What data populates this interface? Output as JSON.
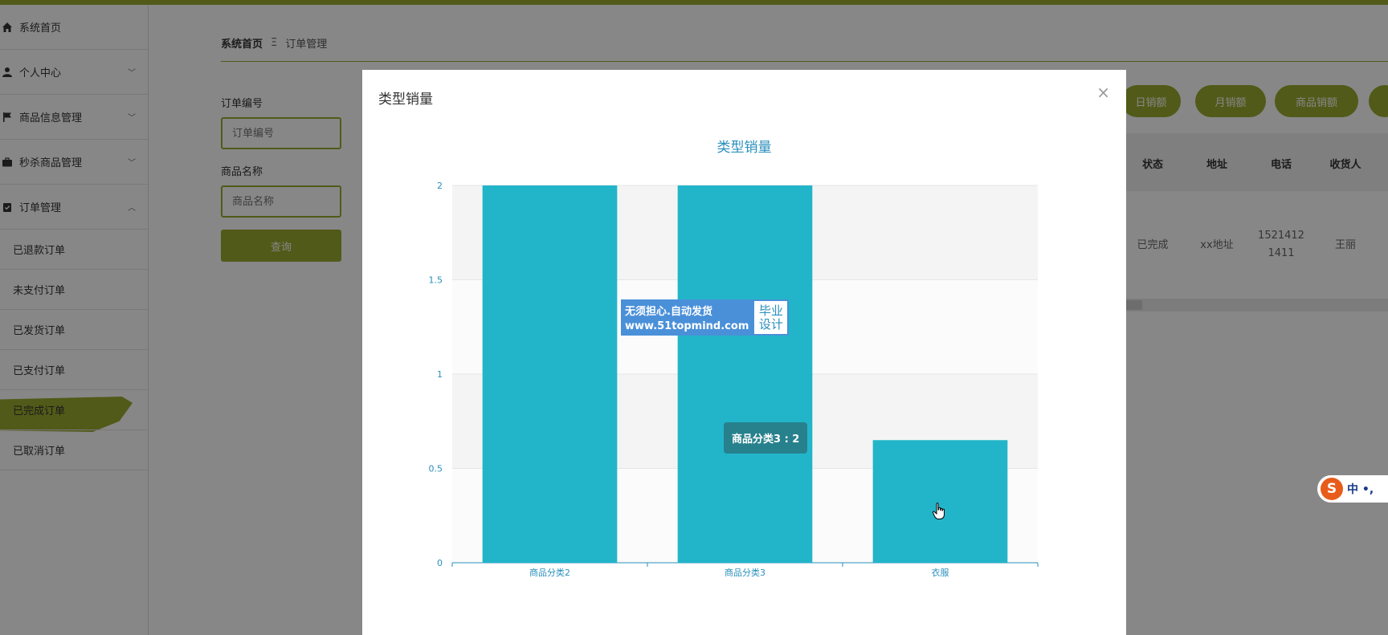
{
  "sidebar": {
    "items": [
      {
        "label": "系统首页",
        "icon": "home-icon",
        "expandable": false
      },
      {
        "label": "个人中心",
        "icon": "user-icon",
        "expandable": true
      },
      {
        "label": "商品信息管理",
        "icon": "flag-icon",
        "expandable": true
      },
      {
        "label": "秒杀商品管理",
        "icon": "briefcase-icon",
        "expandable": true
      },
      {
        "label": "订单管理",
        "icon": "clipboard-icon",
        "expandable": true,
        "expanded": true
      }
    ],
    "sub_items": [
      "已退款订单",
      "未支付订单",
      "已发货订单",
      "已支付订单",
      "已完成订单",
      "已取消订单"
    ],
    "active_sub": "已完成订单"
  },
  "breadcrumb": {
    "home": "系统首页",
    "separator": "Ξ",
    "current": "订单管理"
  },
  "search": {
    "order_no_label": "订单编号",
    "order_no_placeholder": "订单编号",
    "product_name_label": "商品名称",
    "product_name_placeholder": "商品名称",
    "query_label": "查询"
  },
  "stat_buttons": [
    "日销额",
    "月销额",
    "商品销额"
  ],
  "table": {
    "headers": [
      "状态",
      "地址",
      "电话",
      "收货人"
    ],
    "row": {
      "status": "已完成",
      "address": "xx地址",
      "phone_line1": "1521412",
      "phone_line2": "1411",
      "receiver": "王丽"
    }
  },
  "modal": {
    "title": "类型销量",
    "close": "×"
  },
  "chart_data": {
    "type": "bar",
    "title": "类型销量",
    "categories": [
      "商品分类2",
      "商品分类3",
      "衣服"
    ],
    "values": [
      2,
      2,
      0.65
    ],
    "ylim": [
      0,
      2
    ],
    "yticks": [
      "0",
      "0.5",
      "1",
      "1.5",
      "2"
    ],
    "bar_color": "#22b5c9",
    "grid": true
  },
  "tooltip": {
    "text": "商品分类3 : 2"
  },
  "watermark": {
    "line1": "无须担心.自动发货",
    "line2": "www.51topmind.com",
    "right_line1": "毕业",
    "right_line2": "设计"
  },
  "ime": {
    "label": "中 •,"
  },
  "colors": {
    "accent": "#9aab2e",
    "bar": "#22b5c9",
    "title": "#2a8fbd"
  }
}
